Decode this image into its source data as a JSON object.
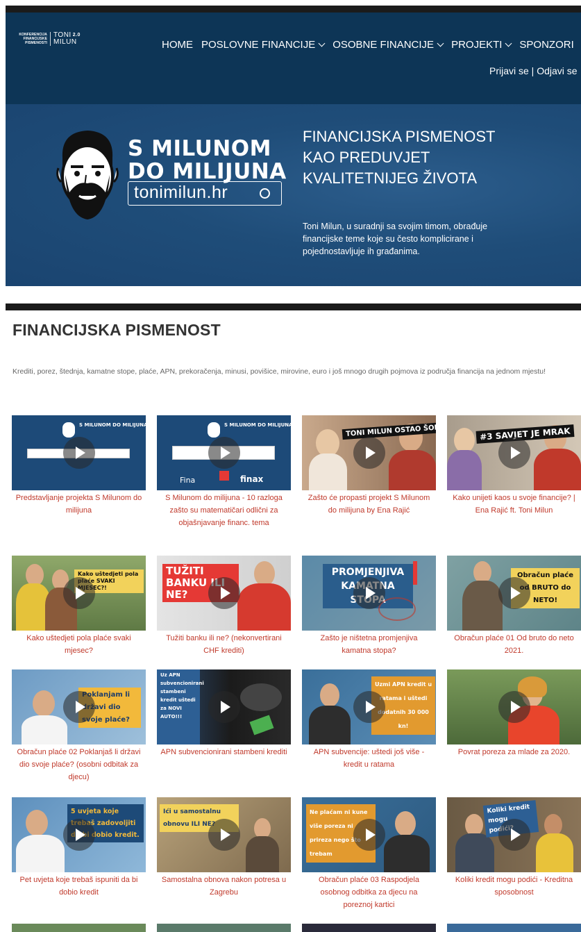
{
  "header": {
    "logo_small": [
      "KONFERENCIJA",
      "FINANCIJSKE",
      "PISMENOSTI"
    ],
    "logo_name_top": "TONI",
    "logo_version": "2.0",
    "logo_name_bottom": "MILUN",
    "nav": [
      {
        "label": "HOME",
        "dropdown": false
      },
      {
        "label": "POSLOVNE FINANCIJE",
        "dropdown": true
      },
      {
        "label": "OSOBNE FINANCIJE",
        "dropdown": true
      },
      {
        "label": "PROJEKTI",
        "dropdown": true
      },
      {
        "label": "SPONZORI",
        "dropdown": false
      }
    ],
    "login_text": "Prijavi se | Odjavi se"
  },
  "hero": {
    "brand_line1": "S MILUNOM",
    "brand_line2": "DO MILIJUNA",
    "brand_url": "tonimilun.hr",
    "title_lines": [
      "FINANCIJSKA PISMENOST",
      "KAO PREDUVJET",
      "KVALITETNIJEG ŽIVOTA"
    ],
    "text": "Toni Milun, u suradnji sa svojim timom, obrađuje financijske teme koje su često komplicirane i pojednostavljuje ih građanima."
  },
  "section": {
    "title": "FINANCIJSKA PISMENOST",
    "description": "Krediti, porez, štednja, kamatne stope, plaće, APN, prekoračenja, minusi, povišice, mirovine, euro i još mnogo drugih pojmova iz područja financija na jednom mjestu!"
  },
  "videos": [
    {
      "title": "Predstavljanje projekta S Milunom do milijuna",
      "overlay": "S MILUNOM DO MILIJUNA"
    },
    {
      "title": "S Milunom do milijuna - 10 razloga zašto su matematičari odlični za objašnjavanje financ. tema",
      "overlay": "S MILUNOM DO MILIJUNA",
      "sponsors": [
        "Fina",
        "finax"
      ]
    },
    {
      "title": "Zašto će propasti projekt S Milunom do milijuna by Ena Rajić",
      "overlay": "TONI MILUN OSTAO ŠOKIRAN!"
    },
    {
      "title": "Kako unijeti kaos u svoje financije? | Ena Rajić ft. Toni Milun",
      "overlay": "#3 SAVJET JE MRAK"
    },
    {
      "title": "Kako uštedjeti pola plaće svaki mjesec?",
      "overlay": "Kako uštedjeti pola plaće SVAKI MJESEC?!"
    },
    {
      "title": "Tužiti banku ili ne? (nekonvertirani CHF krediti)",
      "overlay": "TUŽITI BANKU ILI NE?"
    },
    {
      "title": "Zašto je ništetna promjenjiva kamatna stopa?",
      "overlay": "PROMJENJIVA KAMATNA STOPA"
    },
    {
      "title": "Obračun plaće 01 Od bruto do neto 2021.",
      "overlay": "Obračun plaće od BRUTO do NETO!"
    },
    {
      "title": "Obračun plaće 02 Poklanjaš li državi dio svoje plaće? (osobni odbitak za djecu)",
      "overlay": "Poklanjam li državi dio svoje plaće?"
    },
    {
      "title": "APN subvencionirani stambeni krediti",
      "overlay": "Uz APN subvencionirani stambeni kredit uštedi za NOVI AUTO!!!"
    },
    {
      "title": "APN subvencije: uštedi još više - kredit u ratama",
      "overlay": "Uzmi APN kredit u ratama i uštedi dodatnih 30 000 kn!"
    },
    {
      "title": "Povrat poreza za mlade za 2020.",
      "overlay": ""
    },
    {
      "title": "Pet uvjeta koje trebaš ispuniti da bi dobio kredit",
      "overlay": "5 uvjeta koje trebaš zadovoljiti da bi dobio kredit."
    },
    {
      "title": "Samostalna obnova nakon potresa u Zagrebu",
      "overlay": "Ići u samostalnu obnovu ILI NE?"
    },
    {
      "title": "Obračun plaće 03 Raspodjela osobnog odbitka za djecu na poreznoj kartici",
      "overlay": "Ne plaćam ni kune više poreza ni prireza nego što trebam"
    },
    {
      "title": "Koliki kredit mogu podići - Kreditna sposobnost",
      "overlay": "Koliki kredit mogu podići?"
    }
  ]
}
